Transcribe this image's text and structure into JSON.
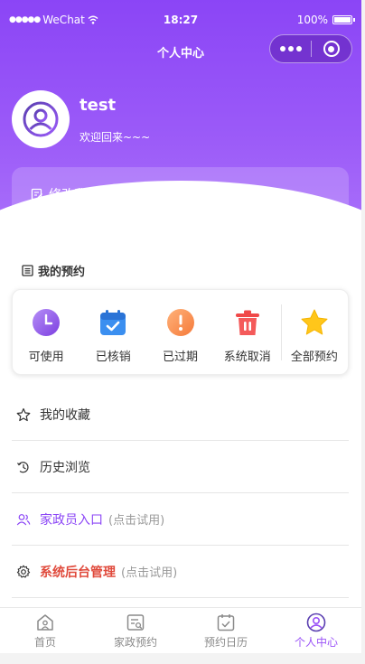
{
  "status_bar": {
    "carrier": "WeChat",
    "time": "18:27",
    "battery": "100%"
  },
  "nav": {
    "title": "个人中心"
  },
  "profile": {
    "username": "test",
    "welcome": "欢迎回来~~~",
    "edit_profile": "修改我的个人资料"
  },
  "appointments": {
    "title": "我的预约",
    "items": [
      {
        "label": "可使用",
        "icon": "clock-icon"
      },
      {
        "label": "已核销",
        "icon": "calendar-check-icon"
      },
      {
        "label": "已过期",
        "icon": "alert-icon"
      },
      {
        "label": "系统取消",
        "icon": "trash-icon"
      },
      {
        "label": "全部预约",
        "icon": "star-icon"
      }
    ]
  },
  "menu": {
    "favorites": "我的收藏",
    "history": "历史浏览",
    "housekeeper_entry": "家政员入口",
    "housekeeper_hint": "(点击试用)",
    "admin": "系统后台管理",
    "admin_hint": "(点击试用)"
  },
  "tabbar": {
    "items": [
      {
        "label": "首页",
        "icon": "home-icon"
      },
      {
        "label": "家政预约",
        "icon": "booking-icon"
      },
      {
        "label": "预约日历",
        "icon": "calendar-icon"
      },
      {
        "label": "个人中心",
        "icon": "user-icon",
        "active": true
      }
    ]
  },
  "colors": {
    "brand_purple": "#8b45f6",
    "admin_red": "#e04a3c"
  }
}
